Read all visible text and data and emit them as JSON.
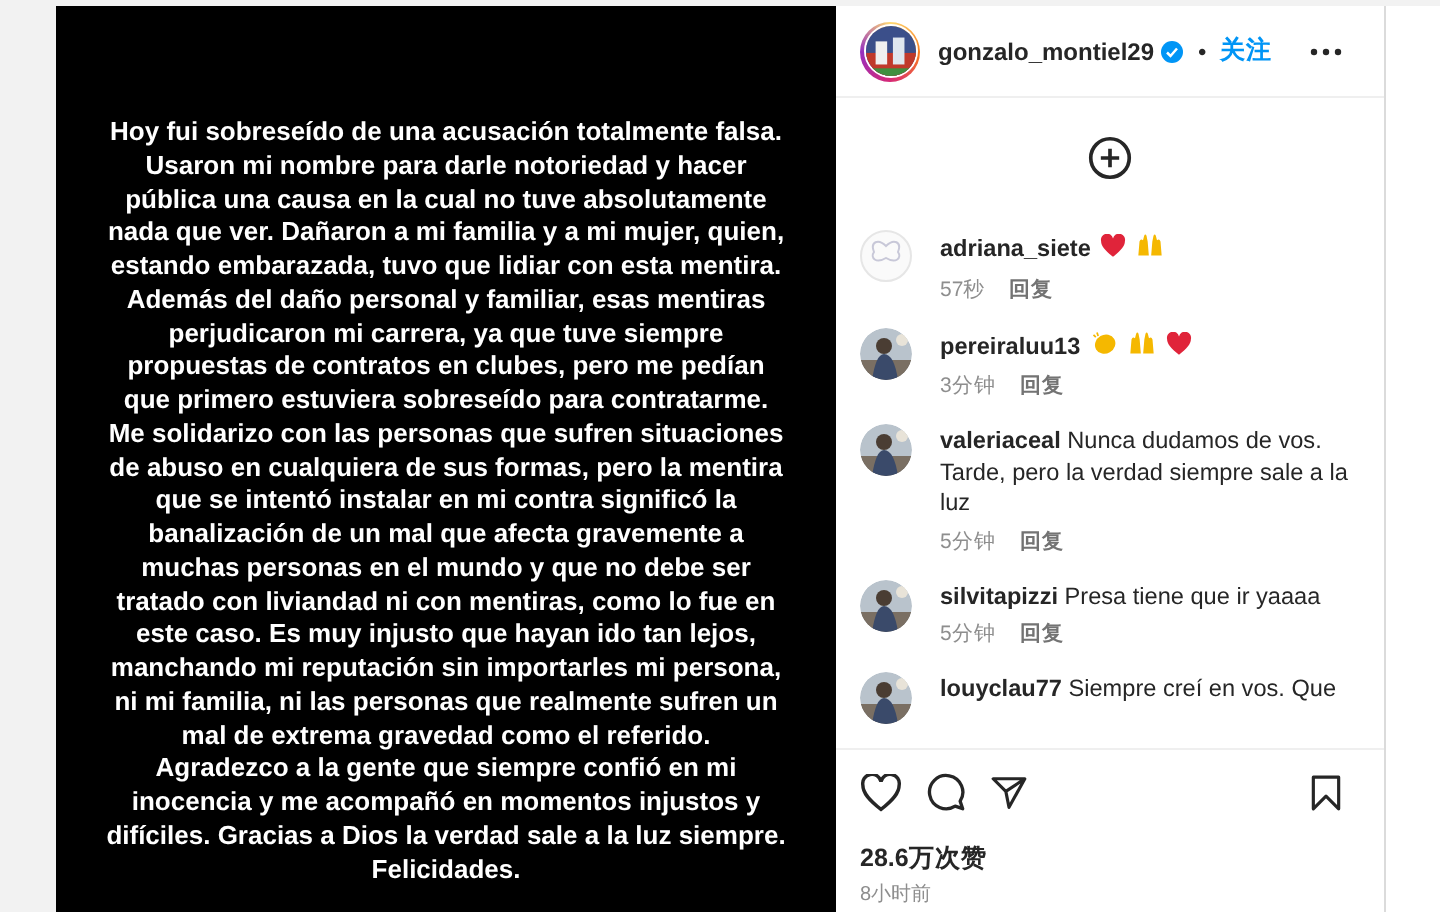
{
  "post_image": {
    "lines": [
      "Hoy fui sobreseído de una acusación totalmente falsa.",
      "Usaron mi nombre para darle notoriedad y hacer",
      "pública una causa en la cual no tuve absolutamente",
      "nada que ver. Dañaron a mi familia y a mi mujer, quien,",
      "estando embarazada, tuvo que lidiar con esta mentira.",
      "Además del daño personal y familiar, esas mentiras",
      "perjudicaron mi carrera, ya que tuve siempre",
      "propuestas de contratos en clubes, pero me pedían",
      "que primero estuviera sobreseído para contratarme.",
      "Me solidarizo con las personas que sufren situaciones",
      "de abuso en cualquiera de sus formas, pero la mentira",
      "que se intentó instalar en mi contra significó la",
      "banalización de un mal que afecta gravemente a",
      "muchas personas en el mundo y que no debe ser",
      "tratado con liviandad ni con mentiras, como lo fue en",
      "este caso. Es muy injusto que hayan ido tan lejos,",
      "manchando mi reputación sin importarles mi persona,",
      "ni mi familia, ni las personas que realmente sufren un",
      "mal de extrema gravedad como el referido.",
      "Agradezco a la gente que siempre confió en mi",
      "inocencia y me acompañó en momentos injustos y",
      "difíciles. Gracias a Dios la verdad sale a la luz siempre.",
      "Felicidades."
    ]
  },
  "header": {
    "username": "gonzalo_montiel29",
    "verified": true,
    "separator": "•",
    "follow": "关注"
  },
  "comments": [
    {
      "avatar": {
        "kind": "butterfly"
      },
      "user": "adriana_siete",
      "emoji": [
        {
          "kind": "heart"
        },
        {
          "kind": "raised-hands"
        }
      ],
      "time": "57秒",
      "reply": "回复"
    },
    {
      "user": "pereiraluu13",
      "emoji": [
        {
          "kind": "clapping-hands"
        },
        {
          "kind": "raised-hands"
        },
        {
          "kind": "heart"
        }
      ],
      "time": "3分钟",
      "reply": "回复"
    },
    {
      "user": "valeriaceal",
      "text": "Nunca dudamos de vos. Tarde, pero la verdad siempre sale a la luz",
      "time": "5分钟",
      "reply": "回复"
    },
    {
      "user": "silvitapizzi",
      "text": "Presa tiene que ir yaaaa",
      "time": "5分钟",
      "reply": "回复"
    },
    {
      "user": "louyclau77",
      "text": "Siempre creí en vos. Que"
    }
  ],
  "likes": "28.6万次赞",
  "posted": "8小时前"
}
